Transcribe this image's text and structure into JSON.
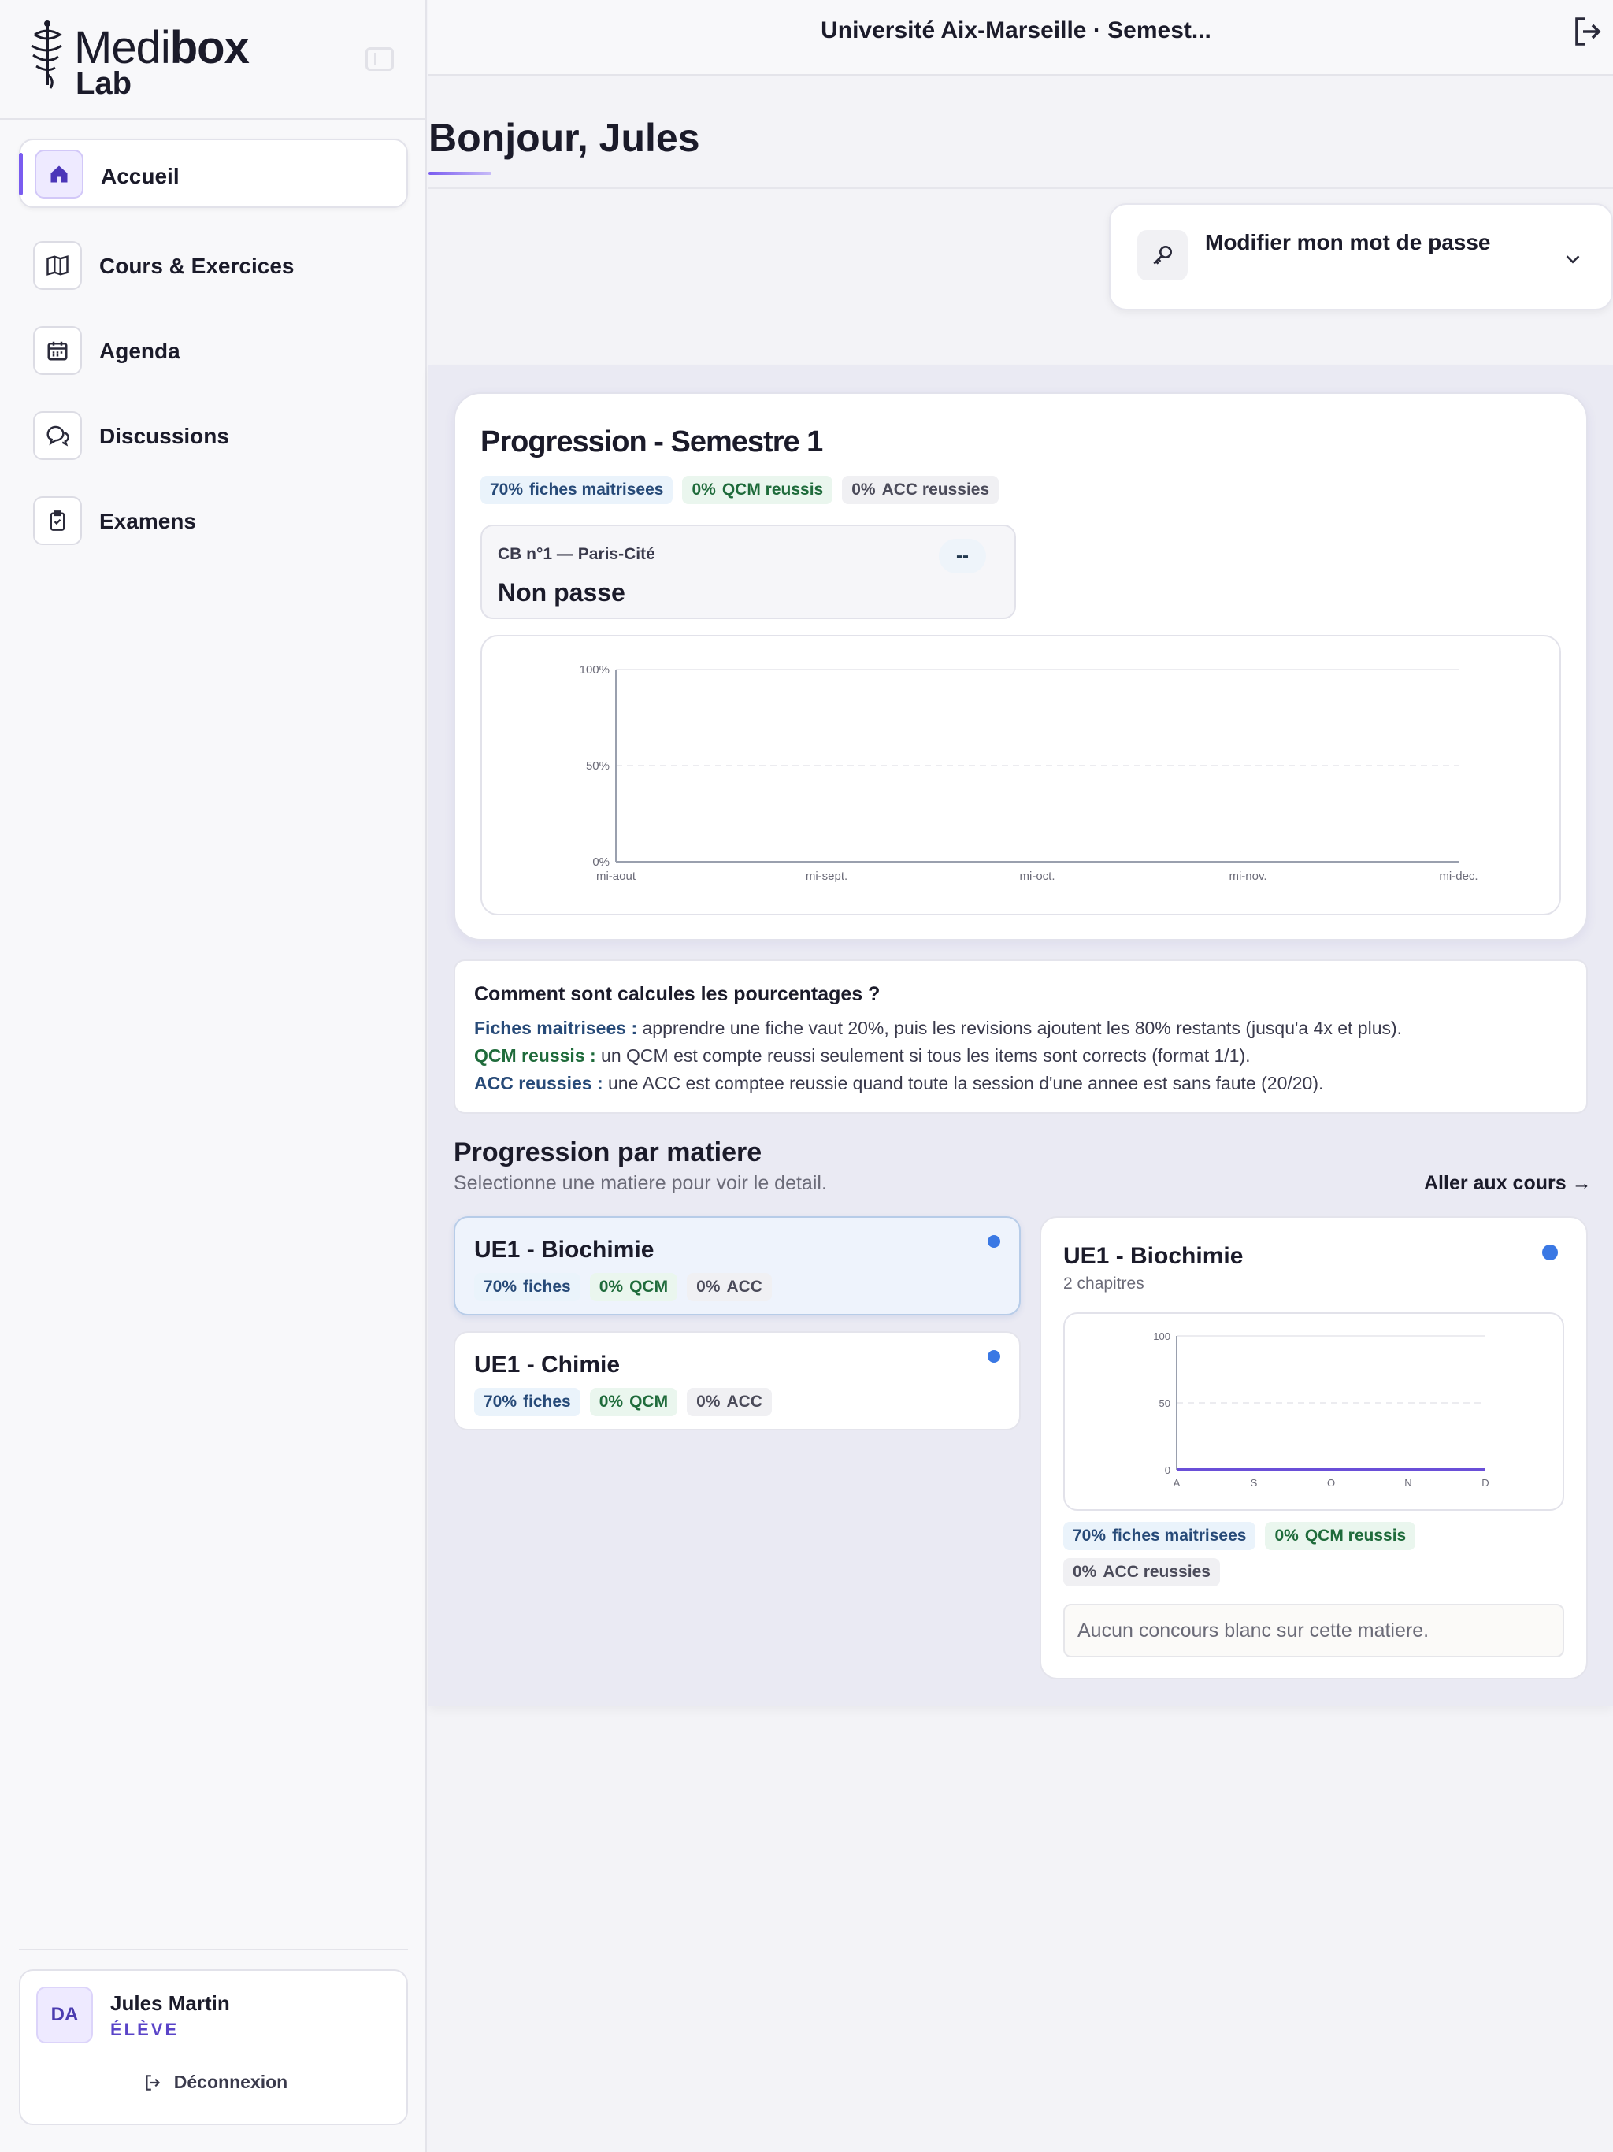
{
  "brand": {
    "name_part1": "Medi",
    "name_part2": "box",
    "name_line2": "Lab"
  },
  "sidebar": {
    "items": [
      {
        "label": "Accueil",
        "icon": "home-icon",
        "active": true
      },
      {
        "label": "Cours & Exercices",
        "icon": "book-icon"
      },
      {
        "label": "Agenda",
        "icon": "calendar-icon"
      },
      {
        "label": "Discussions",
        "icon": "chat-icon"
      },
      {
        "label": "Examens",
        "icon": "clipboard-check-icon"
      }
    ]
  },
  "user": {
    "initials": "DA",
    "name": "Jules Martin",
    "role": "ÉLÈVE",
    "logout_label": "Déconnexion"
  },
  "topbar": {
    "title": "Université Aix-Marseille · Semest..."
  },
  "greeting": "Bonjour, Jules",
  "password": {
    "label": "Modifier mon mot de passe"
  },
  "progression": {
    "title": "Progression - Semestre 1",
    "stats": [
      {
        "value": "70%",
        "label": "fiches maitrisees",
        "tone": "blue"
      },
      {
        "value": "0%",
        "label": "QCM reussis",
        "tone": "green"
      },
      {
        "value": "0%",
        "label": "ACC reussies",
        "tone": "gray"
      }
    ],
    "cb": {
      "label": "CB n°1 — Paris-Cité",
      "status": "Non passe",
      "badge": "--"
    }
  },
  "info": {
    "title": "Comment sont calcules les pourcentages ?",
    "rows": [
      {
        "term": "Fiches maitrisees :",
        "text": " apprendre une fiche vaut 20%, puis les revisions ajoutent les 80% restants (jusqu'a 4x et plus).",
        "color": "#274a78"
      },
      {
        "term": "QCM reussis :",
        "text": " un QCM est compte reussi seulement si tous les items sont corrects (format 1/1).",
        "color": "#1f6b3b"
      },
      {
        "term": "ACC reussies :",
        "text": " une ACC est comptee reussie quand toute la session d'une annee est sans faute (20/20).",
        "color": "#274a78"
      }
    ]
  },
  "subjects_section": {
    "title": "Progression par matiere",
    "subtitle": "Selectionne une matiere pour voir le detail.",
    "goto_label": "Aller aux cours →"
  },
  "subjects": [
    {
      "title": "UE1 - Biochimie",
      "fiches": "70%",
      "qcm": "0%",
      "acc": "0%",
      "fiches_label": "fiches",
      "qcm_label": "QCM",
      "acc_label": "ACC",
      "selected": true
    },
    {
      "title": "UE1 - Chimie",
      "fiches": "70%",
      "qcm": "0%",
      "acc": "0%",
      "fiches_label": "fiches",
      "qcm_label": "QCM",
      "acc_label": "ACC",
      "selected": false
    }
  ],
  "detail": {
    "title": "UE1 - Biochimie",
    "subtitle": "2 chapitres",
    "stats": [
      {
        "value": "70%",
        "label": "fiches maitrisees",
        "tone": "blue"
      },
      {
        "value": "0%",
        "label": "QCM reussis",
        "tone": "green"
      },
      {
        "value": "0%",
        "label": "ACC reussies",
        "tone": "gray"
      }
    ],
    "empty_label": "Aucun concours blanc sur cette matiere."
  },
  "chart_data": [
    {
      "type": "line",
      "x": [
        "mi-aout",
        "mi-sept.",
        "mi-oct.",
        "mi-nov.",
        "mi-dec."
      ],
      "y_ticks": [
        "0%",
        "50%",
        "100%"
      ],
      "ylim": [
        0,
        100
      ],
      "series": [
        {
          "values": []
        }
      ],
      "grid": true
    },
    {
      "type": "line",
      "x": [
        "A",
        "S",
        "O",
        "N",
        "D"
      ],
      "y_ticks": [
        "0",
        "50",
        "100"
      ],
      "ylim": [
        0,
        100
      ],
      "series": [
        {
          "values": [
            0,
            0,
            0,
            0,
            0
          ],
          "color": "#6a4fd8"
        }
      ],
      "grid": true
    }
  ],
  "colors": {
    "accent": "#7a5cf0",
    "dot": "#3a78e4"
  }
}
